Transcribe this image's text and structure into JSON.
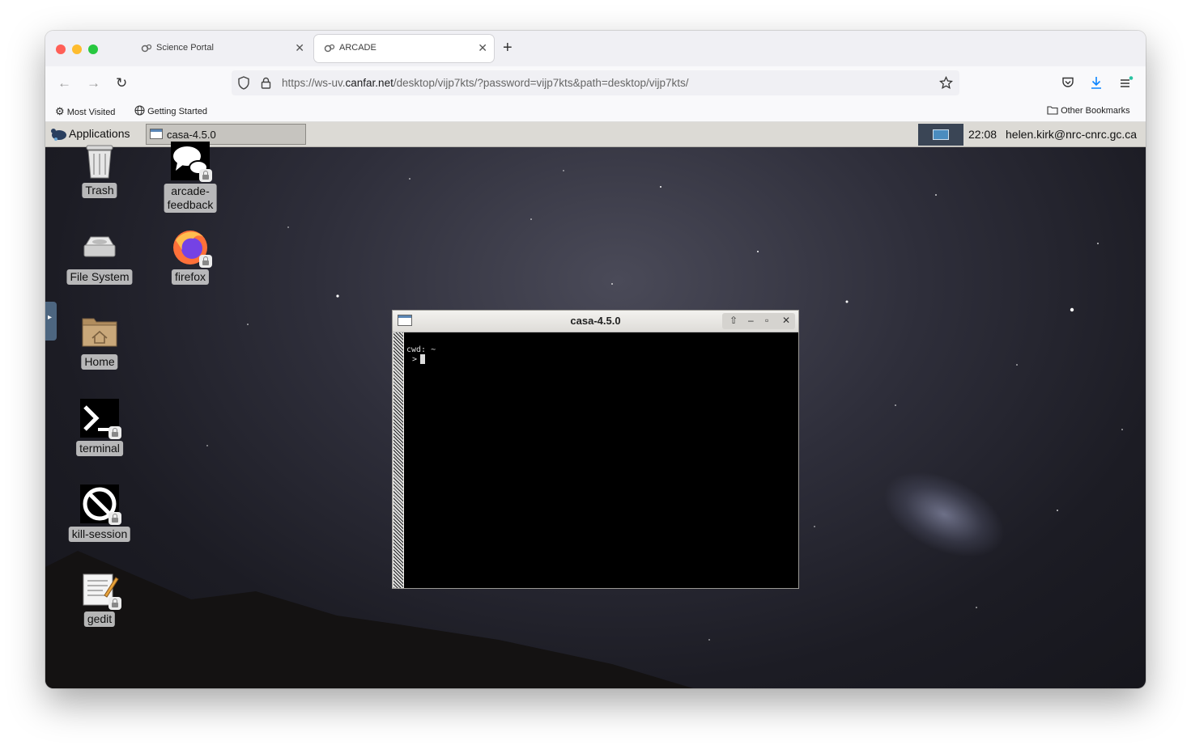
{
  "browser": {
    "tabs": [
      {
        "label": "Science Portal",
        "active": false,
        "icon": "gears-icon"
      },
      {
        "label": "ARCADE",
        "active": true,
        "icon": "gears-icon"
      }
    ],
    "new_tab_label": "+",
    "url": {
      "prefix": "https://ws-uv.",
      "host": "canfar.net",
      "path": "/desktop/vijp7kts/?password=vijp7kts&path=desktop/vijp7kts/"
    },
    "bookmarks": {
      "most_visited": "Most Visited",
      "getting_started": "Getting Started",
      "other": "Other Bookmarks"
    }
  },
  "desktop": {
    "panel": {
      "applications_label": "Applications",
      "task_label": "casa-4.5.0",
      "clock": "22:08",
      "user": "helen.kirk@nrc-cnrc.gc.ca"
    },
    "icons_left": [
      {
        "label": "Trash",
        "icon": "trash-icon"
      },
      {
        "label": "File System",
        "icon": "drive-icon"
      },
      {
        "label": "Home",
        "icon": "home-folder-icon"
      },
      {
        "label": "terminal",
        "icon": "terminal-icon"
      },
      {
        "label": "kill-session",
        "icon": "kill-icon"
      },
      {
        "label": "gedit",
        "icon": "text-editor-icon"
      }
    ],
    "icons_right": [
      {
        "label": "arcade-\nfeedback",
        "icon": "chat-icon"
      },
      {
        "label": "firefox",
        "icon": "firefox-icon"
      }
    ],
    "terminal": {
      "title": "casa-4.5.0",
      "line1": "cwd: ~",
      "prompt": ">"
    }
  },
  "colors": {
    "close": "#ff5f57",
    "minimize": "#febc2e",
    "zoom": "#28c840",
    "download_accent": "#0a84ff"
  }
}
